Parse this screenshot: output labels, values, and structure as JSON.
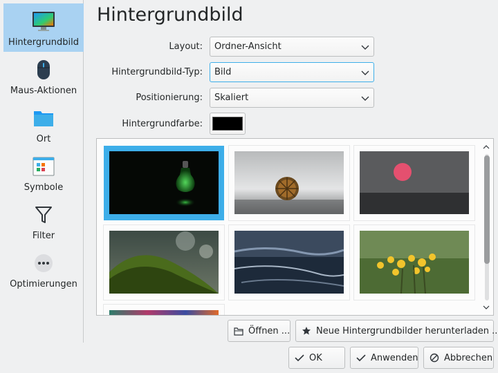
{
  "sidebar": {
    "items": [
      {
        "label": "Hintergrundbild",
        "icon": "monitor-wallpaper-icon",
        "active": true
      },
      {
        "label": "Maus-Aktionen",
        "icon": "mouse-icon"
      },
      {
        "label": "Ort",
        "icon": "folder-icon"
      },
      {
        "label": "Symbole",
        "icon": "icons-grid-icon"
      },
      {
        "label": "Filter",
        "icon": "filter-funnel-icon"
      },
      {
        "label": "Optimierungen",
        "icon": "more-options-icon"
      }
    ]
  },
  "page": {
    "title": "Hintergrundbild"
  },
  "form": {
    "layout": {
      "label": "Layout:",
      "value": "Ordner-Ansicht"
    },
    "type": {
      "label": "Hintergrundbild-Typ:",
      "value": "Bild"
    },
    "position": {
      "label": "Positionierung:",
      "value": "Skaliert"
    },
    "color": {
      "label": "Hintergrundfarbe:",
      "value": "#000000"
    }
  },
  "wallpapers": [
    {
      "name": "green-lightbulb",
      "selected": true
    },
    {
      "name": "chestnut-burr"
    },
    {
      "name": "red-sun-over-sea"
    },
    {
      "name": "moss-on-rock"
    },
    {
      "name": "dark-beach-waves"
    },
    {
      "name": "yellow-flowers"
    },
    {
      "name": "colorful-partial"
    }
  ],
  "buttons": {
    "open": "Öffnen ...",
    "download": "Neue Hintergrundbilder herunterladen ...",
    "ok": "OK",
    "apply": "Anwenden",
    "cancel": "Abbrechen"
  },
  "colors": {
    "accent": "#3daee9",
    "sidebar_active": "#a9d2f2",
    "background": "#eff0f1"
  }
}
